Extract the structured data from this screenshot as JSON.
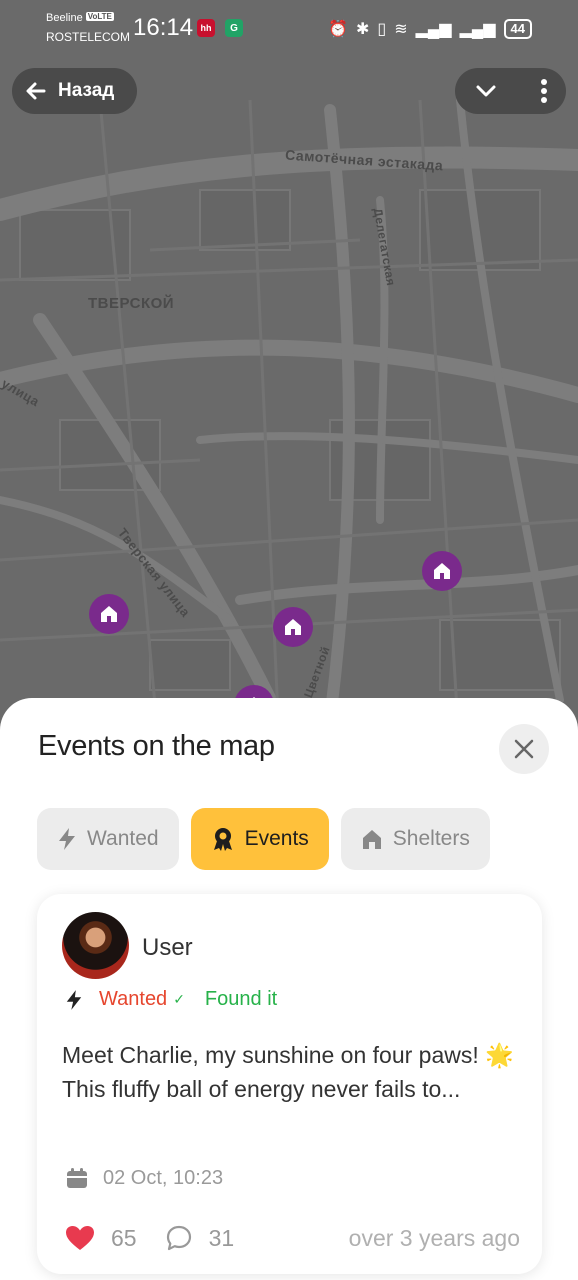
{
  "status_bar": {
    "carrier_top": "Beeline",
    "volte": "VoLTE",
    "carrier_bottom": "ROSTELECOM",
    "time": "16:14",
    "app1": "hh",
    "app2": "G",
    "battery": "44"
  },
  "header": {
    "back_label": "Назад"
  },
  "map": {
    "labels": {
      "district": "ТВЕРСКОЙ",
      "overpass": "Самотёчная эстакада",
      "street1": "Тверская улица",
      "street2": "улица",
      "street3": "Цветной",
      "street4": "Делегатская"
    },
    "pin_color": "#7a2a8c"
  },
  "sheet": {
    "title": "Events on the map",
    "tabs": [
      {
        "label": "Wanted",
        "icon": "lightning-icon",
        "active": false
      },
      {
        "label": "Events",
        "icon": "medal-icon",
        "active": true
      },
      {
        "label": "Shelters",
        "icon": "house-icon",
        "active": false
      }
    ]
  },
  "card": {
    "user": "User",
    "status_wanted": "Wanted",
    "status_check": "✓",
    "status_found": "Found it",
    "description": "Meet Charlie, my sunshine on four paws! 🌟 This fluffy ball of energy never fails to...",
    "date": "02 Oct, 10:23",
    "likes": "65",
    "comments": "31",
    "ago": "over 3 years ago"
  },
  "colors": {
    "accent": "#ffc13b",
    "wanted": "#e6462e",
    "found": "#27b24a",
    "like": "#e83a4f"
  }
}
